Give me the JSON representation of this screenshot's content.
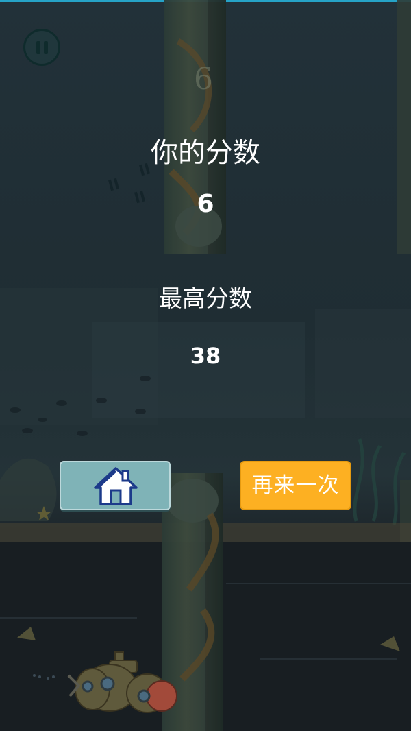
{
  "game": {
    "top_strip_color": "#26a3c7",
    "ghost_score": "6",
    "pause_icon": "pause-icon"
  },
  "game_over": {
    "your_score_label": "你的分数",
    "your_score_value": "6",
    "best_score_label": "最高分数",
    "best_score_value": "38"
  },
  "buttons": {
    "home_icon": "home-icon",
    "home_color": "#7fb3b7",
    "retry_label": "再来一次",
    "retry_color": "#fdb022"
  }
}
